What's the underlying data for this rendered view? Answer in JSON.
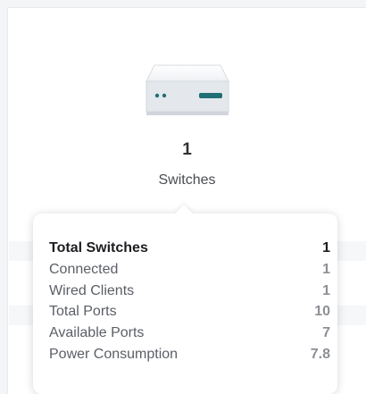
{
  "summary": {
    "count": "1",
    "label": "Switches",
    "icon": "switch-device-icon"
  },
  "tooltip": {
    "rows": [
      {
        "key": "Total Switches",
        "value": "1"
      },
      {
        "key": "Connected",
        "value": "1"
      },
      {
        "key": "Wired Clients",
        "value": "1"
      },
      {
        "key": "Total Ports",
        "value": "10"
      },
      {
        "key": "Available Ports",
        "value": "7"
      },
      {
        "key": "Power Consumption",
        "value": "7.8"
      }
    ]
  },
  "colors": {
    "device_body": "#e9ecf0",
    "device_accent": "#1f6f74"
  }
}
